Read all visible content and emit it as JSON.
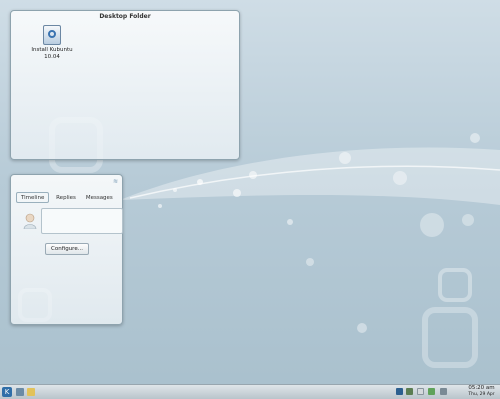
{
  "desktop_folder": {
    "title": "Desktop Folder",
    "icon_label": "Install Kubuntu 10.04",
    "icon_name": "installer-icon"
  },
  "microblog": {
    "tabs": [
      "Timeline",
      "Replies",
      "Messages"
    ],
    "active_tab": "Timeline",
    "configure_label": "Configure..."
  },
  "taskbar": {
    "icons": [
      "kmenu-icon",
      "computer-icon",
      "folder-icon",
      "network-icon",
      "battery-icon",
      "clipboard-icon",
      "notifications-icon",
      "volume-icon"
    ],
    "clock_time": "05:20 am",
    "clock_date": "Thu, 29 Apr"
  },
  "colors": {
    "accent": "#2f6ea8",
    "panel_border": "#8ea3ae"
  }
}
